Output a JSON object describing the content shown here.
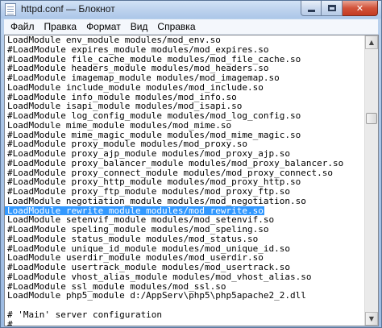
{
  "window": {
    "title": "httpd.conf — Блокнот"
  },
  "menu": [
    "Файл",
    "Правка",
    "Формат",
    "Вид",
    "Справка"
  ],
  "editor": {
    "lines": [
      "LoadModule env_module modules/mod_env.so",
      "#LoadModule expires_module modules/mod_expires.so",
      "#LoadModule file_cache_module modules/mod_file_cache.so",
      "#LoadModule headers_module modules/mod_headers.so",
      "#LoadModule imagemap_module modules/mod_imagemap.so",
      "LoadModule include_module modules/mod_include.so",
      "#LoadModule info_module modules/mod_info.so",
      "LoadModule isapi_module modules/mod_isapi.so",
      "#LoadModule log_config_module modules/mod_log_config.so",
      "LoadModule mime_module modules/mod_mime.so",
      "#LoadModule mime_magic_module modules/mod_mime_magic.so",
      "#LoadModule proxy_module modules/mod_proxy.so",
      "#LoadModule proxy_ajp_module modules/mod_proxy_ajp.so",
      "#LoadModule proxy_balancer_module modules/mod_proxy_balancer.so",
      "#LoadModule proxy_connect_module modules/mod_proxy_connect.so",
      "#LoadModule proxy_http_module modules/mod_proxy_http.so",
      "#LoadModule proxy_ftp_module modules/mod_proxy_ftp.so",
      "LoadModule negotiation_module modules/mod_negotiation.so",
      "LoadModule rewrite_module modules/mod_rewrite.so",
      "LoadModule setenvif_module modules/mod_setenvif.so",
      "#LoadModule speling_module modules/mod_speling.so",
      "#LoadModule status_module modules/mod_status.so",
      "#LoadModule unique_id_module modules/mod_unique_id.so",
      "LoadModule userdir_module modules/mod_userdir.so",
      "#LoadModule usertrack_module modules/mod_usertrack.so",
      "#LoadModule vhost_alias_module modules/mod_vhost_alias.so",
      "#LoadModule ssl_module modules/mod_ssl.so",
      "LoadModule php5_module d:/AppServ\\php5\\php5apache2_2.dll",
      "",
      "# 'Main' server configuration",
      "#"
    ],
    "selected_line": 18
  },
  "colors": {
    "selection": "#3399ff",
    "close_button": "#c43b22"
  },
  "icons": {
    "app": "notepad-icon",
    "minimize": "minimize-icon",
    "maximize": "maximize-icon",
    "close": "close-icon",
    "scroll_up": "scroll-up-arrow-icon",
    "scroll_down": "scroll-down-arrow-icon"
  }
}
